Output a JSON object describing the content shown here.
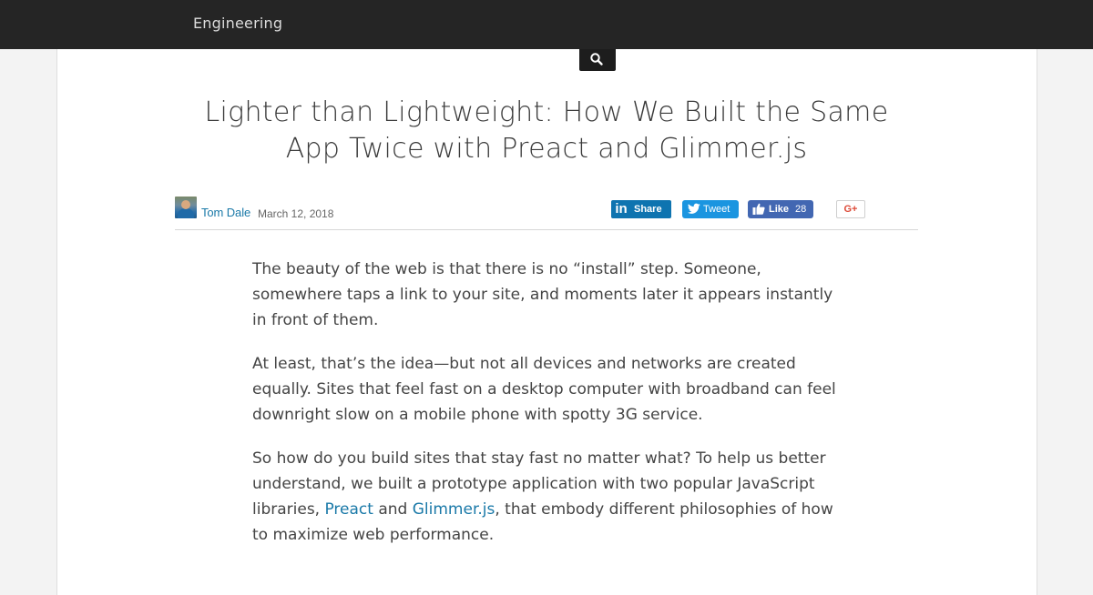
{
  "header": {
    "brand": "Engineering"
  },
  "search": {
    "icon": "search-icon"
  },
  "article": {
    "title": "Lighter than Lightweight: How We Built the Same App Twice with Preact and Glimmer.js",
    "author": "Tom Dale",
    "date": "March 12, 2018",
    "share": {
      "linkedin_label": "Share",
      "tweet_label": "Tweet",
      "like_label": "Like",
      "like_count": "28",
      "gplus_label": "G+"
    },
    "paragraphs": {
      "p1": "The beauty of the web is that there is no “install” step. Someone, somewhere taps a link to your site, and moments later it appears instantly in front of them.",
      "p2": "At least, that’s the idea—but not all devices and networks are created equally. Sites that feel fast on a desktop computer with broadband can feel downright slow on a mobile phone with spotty 3G service.",
      "p3_before": "So how do you build sites that stay fast no matter what? To help us better understand, we built a prototype application with two popular JavaScript libraries, ",
      "p3_link1": "Preact",
      "p3_mid": " and ",
      "p3_link2": "Glimmer.js",
      "p3_after": ", that embody different philosophies of how to maximize web performance."
    }
  },
  "colors": {
    "topbar": "#252525",
    "link": "#1a79a8",
    "linkedin": "#0e74b0",
    "twitter": "#1b95e0",
    "facebook": "#4267b2",
    "gplus": "#dd4b39"
  }
}
